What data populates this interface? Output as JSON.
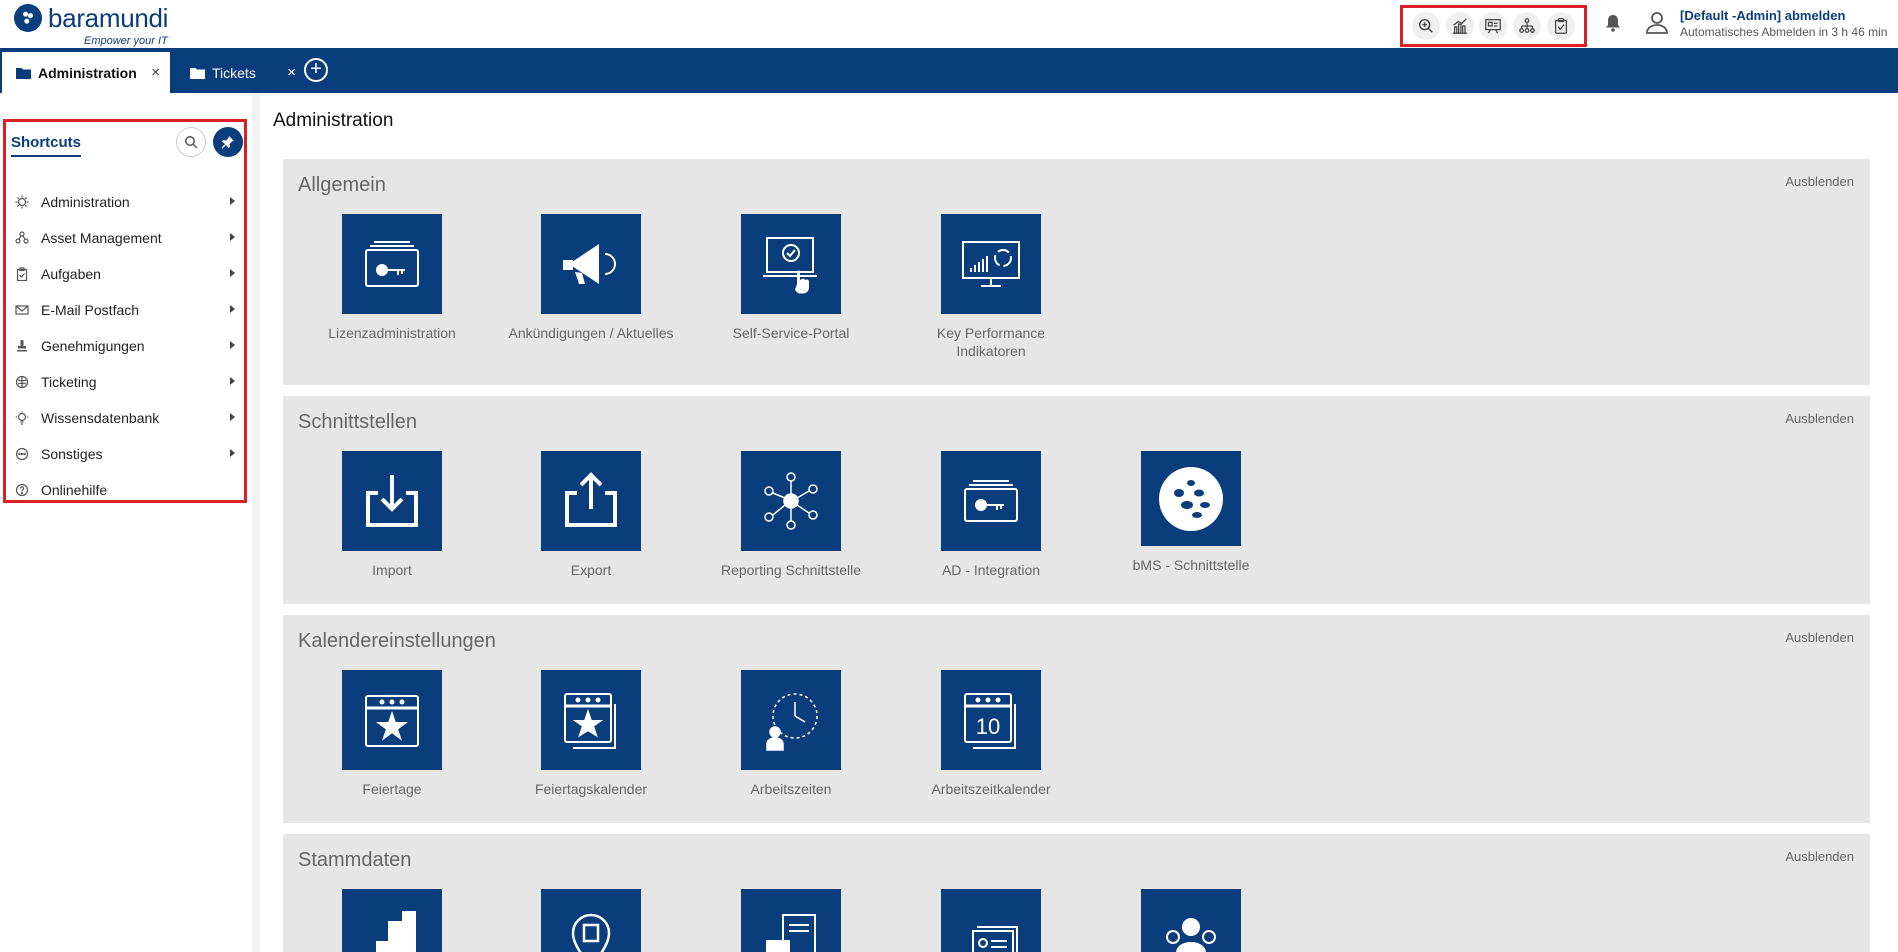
{
  "header": {
    "logo_text": "baramundi",
    "logo_tagline": "Empower your IT",
    "tools": [
      "zoom-search-icon",
      "chart-icon",
      "presentation-icon",
      "hierarchy-icon",
      "clipboard-check-icon"
    ],
    "user_name": "[Default -Admin] abmelden",
    "user_sub": "Automatisches Abmelden in 3 h 46 min"
  },
  "tabs": [
    {
      "label": "Administration",
      "active": true
    },
    {
      "label": "Tickets",
      "active": false
    }
  ],
  "tab_close": "×",
  "tab_add": "+",
  "sidebar": {
    "title": "Shortcuts",
    "items": [
      {
        "label": "Administration",
        "icon": "gear-icon",
        "has_submenu": true
      },
      {
        "label": "Asset Management",
        "icon": "asset-icon",
        "has_submenu": true
      },
      {
        "label": "Aufgaben",
        "icon": "clipboard-icon",
        "has_submenu": true
      },
      {
        "label": "E-Mail Postfach",
        "icon": "mail-icon",
        "has_submenu": true
      },
      {
        "label": "Genehmigungen",
        "icon": "stamp-icon",
        "has_submenu": true
      },
      {
        "label": "Ticketing",
        "icon": "ticketing-icon",
        "has_submenu": true
      },
      {
        "label": "Wissensdatenbank",
        "icon": "lightbulb-icon",
        "has_submenu": true
      },
      {
        "label": "Sonstiges",
        "icon": "more-icon",
        "has_submenu": true
      },
      {
        "label": "Onlinehilfe",
        "icon": "help-icon",
        "has_submenu": false
      }
    ]
  },
  "main": {
    "title": "Administration",
    "hide_label": "Ausblenden",
    "sections": [
      {
        "title": "Allgemein",
        "tiles": [
          {
            "label": "Lizenzadministration",
            "icon": "license-key-icon"
          },
          {
            "label": "Ankündigungen / Aktuelles",
            "icon": "megaphone-icon"
          },
          {
            "label": "Self-Service-Portal",
            "icon": "self-service-icon"
          },
          {
            "label": "Key Performance Indikatoren",
            "icon": "kpi-monitor-icon"
          }
        ]
      },
      {
        "title": "Schnittstellen",
        "tiles": [
          {
            "label": "Import",
            "icon": "import-icon"
          },
          {
            "label": "Export",
            "icon": "export-icon"
          },
          {
            "label": "Reporting Schnittstelle",
            "icon": "network-icon"
          },
          {
            "label": "AD - Integration",
            "icon": "ad-key-icon"
          },
          {
            "label": "bMS - Schnittstelle",
            "icon": "baramundi-logo-icon"
          }
        ]
      },
      {
        "title": "Kalendereinstellungen",
        "tiles": [
          {
            "label": "Feiertage",
            "icon": "calendar-star-icon"
          },
          {
            "label": "Feiertagskalender",
            "icon": "calendar-stack-star-icon"
          },
          {
            "label": "Arbeitszeiten",
            "icon": "clock-person-icon"
          },
          {
            "label": "Arbeitszeitkalender",
            "icon": "calendar-ten-icon",
            "day": "10"
          }
        ]
      },
      {
        "title": "Stammdaten",
        "tiles": [
          {
            "label": "",
            "icon": "building-icon"
          },
          {
            "label": "",
            "icon": "location-icon"
          },
          {
            "label": "",
            "icon": "document-calculator-icon"
          },
          {
            "label": "",
            "icon": "contact-cards-icon"
          },
          {
            "label": "",
            "icon": "people-icon"
          }
        ]
      }
    ]
  }
}
